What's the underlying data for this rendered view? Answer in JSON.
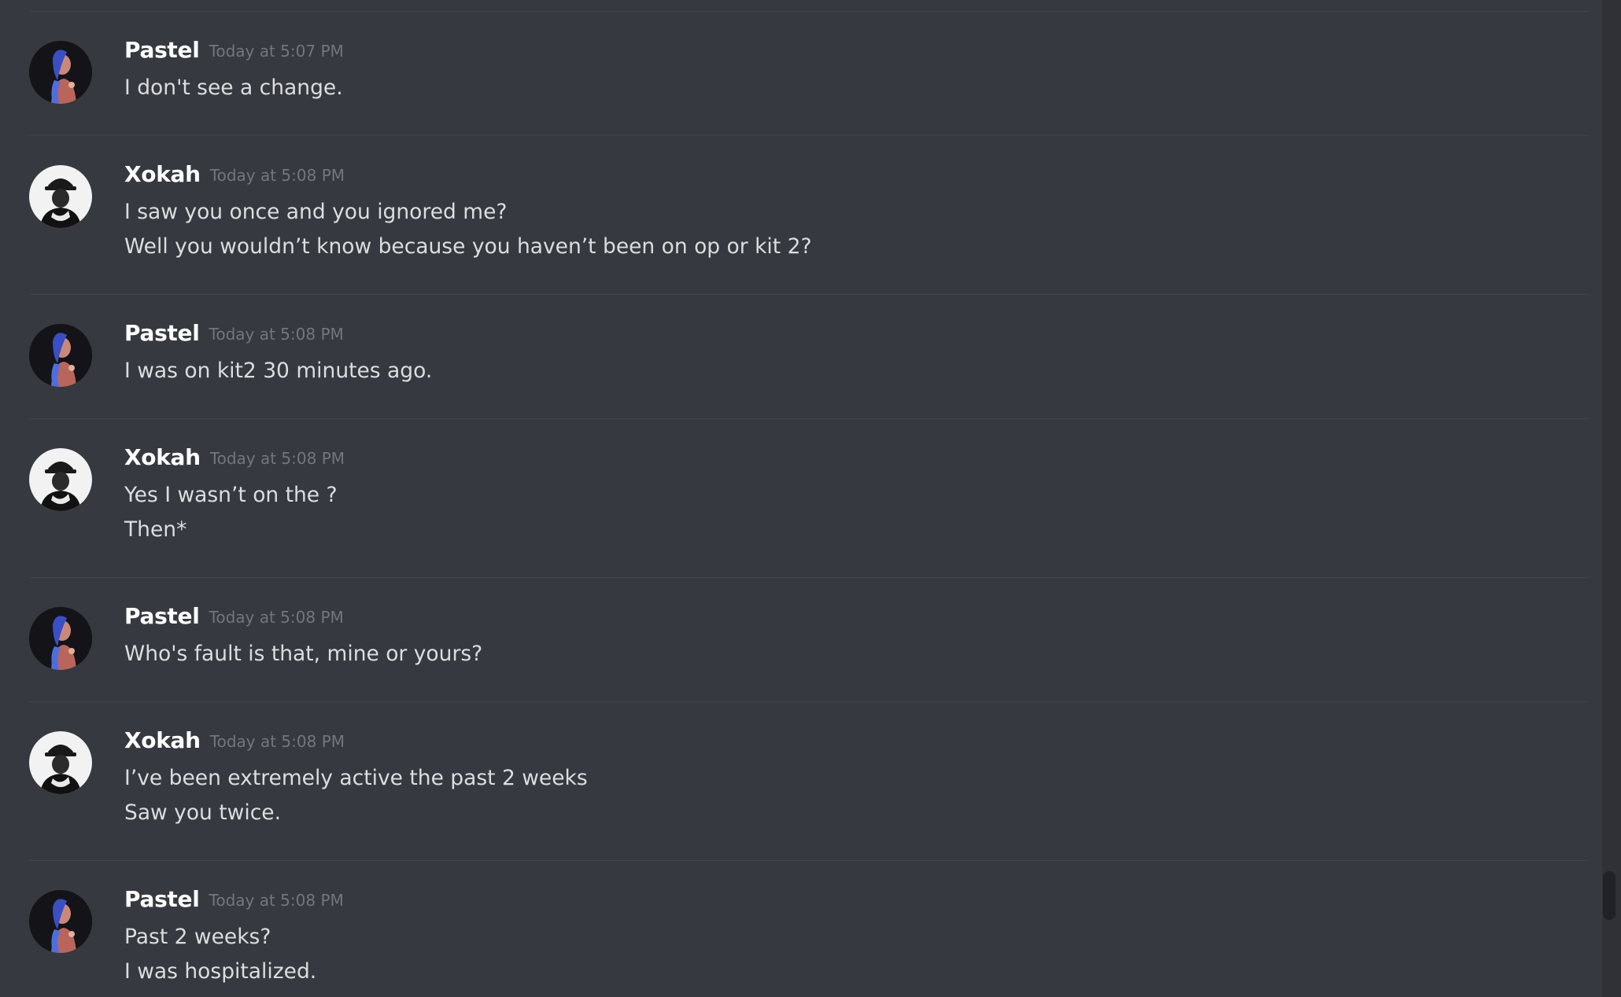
{
  "messages": [
    {
      "author": "Pastel",
      "avatar": "pastel-avatar",
      "timestamp": "Today at 5:07 PM",
      "lines": [
        "I don't see a change."
      ]
    },
    {
      "author": "Xokah",
      "avatar": "xokah-avatar",
      "timestamp": "Today at 5:08 PM",
      "lines": [
        "I saw you once and you ignored me?",
        "Well you wouldn’t know because you haven’t been on op or kit 2?"
      ]
    },
    {
      "author": "Pastel",
      "avatar": "pastel-avatar",
      "timestamp": "Today at 5:08 PM",
      "lines": [
        "I was on kit2 30 minutes ago."
      ]
    },
    {
      "author": "Xokah",
      "avatar": "xokah-avatar",
      "timestamp": "Today at 5:08 PM",
      "lines": [
        "Yes I wasn’t on the ?",
        "Then*"
      ]
    },
    {
      "author": "Pastel",
      "avatar": "pastel-avatar",
      "timestamp": "Today at 5:08 PM",
      "lines": [
        "Who's fault is that, mine or yours?"
      ]
    },
    {
      "author": "Xokah",
      "avatar": "xokah-avatar",
      "timestamp": "Today at 5:08 PM",
      "lines": [
        "I’ve been extremely active the past 2 weeks",
        "Saw you twice."
      ]
    },
    {
      "author": "Pastel",
      "avatar": "pastel-avatar",
      "timestamp": "Today at 5:08 PM",
      "lines": [
        "Past 2 weeks?",
        "I was hospitalized."
      ]
    }
  ],
  "colors": {
    "background": "#36393f",
    "divider": "#41444a",
    "username": "#ffffff",
    "timestamp": "#72767d",
    "message_text": "#dcddde",
    "scrollbar_thumb": "#202225"
  }
}
